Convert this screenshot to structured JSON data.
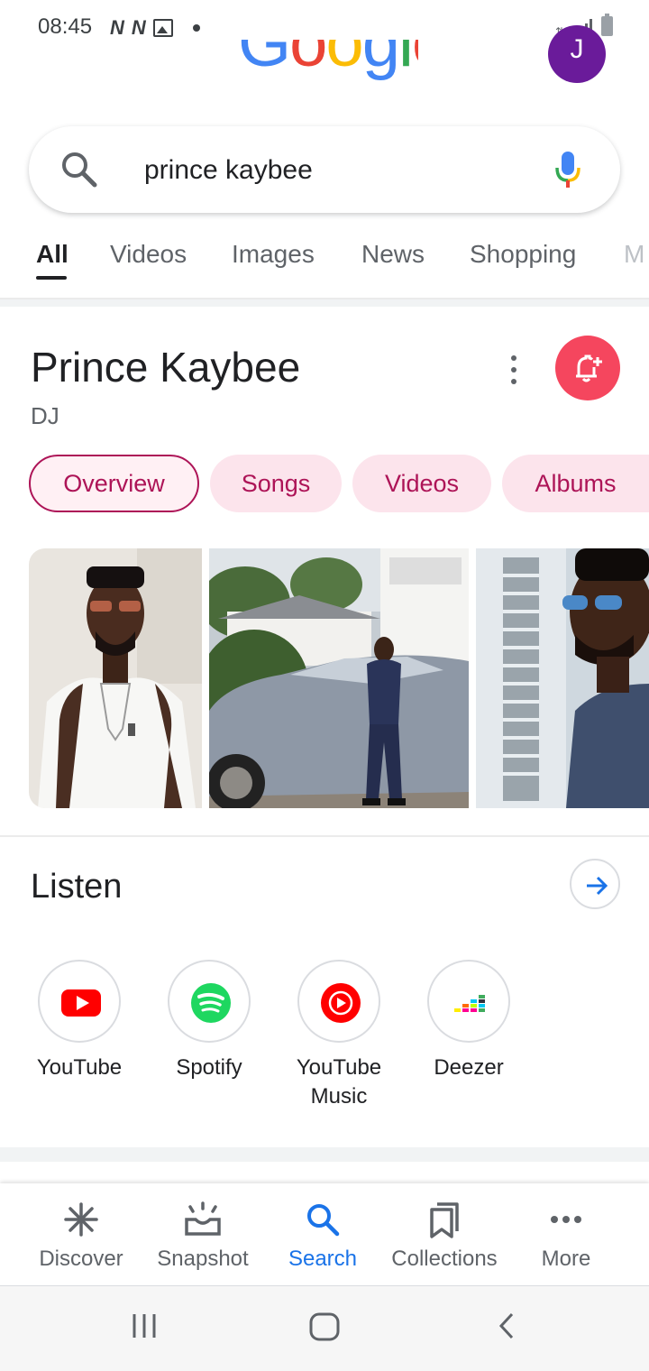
{
  "status_bar": {
    "time": "08:45",
    "notification_icons": [
      "N",
      "N"
    ],
    "image_icon": "image-notification-icon",
    "data_icon": "data-transfer-icon",
    "signal_icon": "signal-icon",
    "battery_icon": "battery-icon"
  },
  "header": {
    "logo_text": "Google",
    "avatar_initial": "J",
    "avatar_color": "#6a1b9a"
  },
  "search": {
    "query": "prince kaybee",
    "search_icon": "search-icon",
    "mic_icon": "mic-icon"
  },
  "tabs": [
    {
      "label": "All",
      "active": true
    },
    {
      "label": "Videos",
      "active": false
    },
    {
      "label": "Images",
      "active": false
    },
    {
      "label": "News",
      "active": false
    },
    {
      "label": "Shopping",
      "active": false
    },
    {
      "label": "M",
      "active": false
    }
  ],
  "entity": {
    "title": "Prince Kaybee",
    "subtitle": "DJ",
    "follow_color": "#f5465e",
    "chips": [
      {
        "label": "Overview",
        "active": true
      },
      {
        "label": "Songs",
        "active": false
      },
      {
        "label": "Videos",
        "active": false
      },
      {
        "label": "Albums",
        "active": false
      }
    ],
    "accent_color": "#ad1457"
  },
  "listen": {
    "title": "Listen",
    "providers": [
      {
        "label": "YouTube",
        "icon": "youtube-icon"
      },
      {
        "label": "Spotify",
        "icon": "spotify-icon"
      },
      {
        "label": "YouTube\nMusic",
        "icon": "youtube-music-icon"
      },
      {
        "label": "Deezer",
        "icon": "deezer-icon"
      }
    ]
  },
  "bottom_nav": [
    {
      "label": "Discover",
      "icon": "discover-icon",
      "active": false
    },
    {
      "label": "Snapshot",
      "icon": "snapshot-icon",
      "active": false
    },
    {
      "label": "Search",
      "icon": "search-icon",
      "active": true
    },
    {
      "label": "Collections",
      "icon": "collections-icon",
      "active": false
    },
    {
      "label": "More",
      "icon": "more-icon",
      "active": false
    }
  ],
  "active_color": "#1a73e8"
}
